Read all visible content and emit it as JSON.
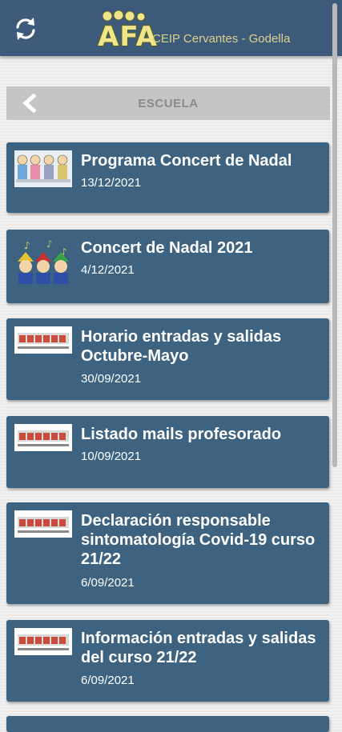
{
  "header": {
    "logo_main": "AFA",
    "logo_sub": "CEIP Cervantes - Godella",
    "colors": {
      "bar": "#3e5a7a",
      "logo": "#f0e58a"
    }
  },
  "section": {
    "title": "ESCUELA"
  },
  "posts": [
    {
      "title": "Programa Concert de Nadal",
      "date": "13/12/2021",
      "thumb": "children-drawing"
    },
    {
      "title": "Concert de Nadal 2021",
      "date": "4/12/2021",
      "thumb": "singing-children"
    },
    {
      "title": "Horario entradas y salidas Octubre-Mayo",
      "date": "30/09/2021",
      "thumb": "school-banner"
    },
    {
      "title": "Listado mails profesorado",
      "date": "10/09/2021",
      "thumb": "school-banner"
    },
    {
      "title": "Declaración responsable sintomatología Covid-19 curso 21/22",
      "date": "6/09/2021",
      "thumb": "school-banner"
    },
    {
      "title": "Información entradas y salidas del curso 21/22",
      "date": "6/09/2021",
      "thumb": "school-banner"
    }
  ],
  "colors": {
    "card": "#3d6380",
    "section_bar": "#c5c5c5"
  }
}
